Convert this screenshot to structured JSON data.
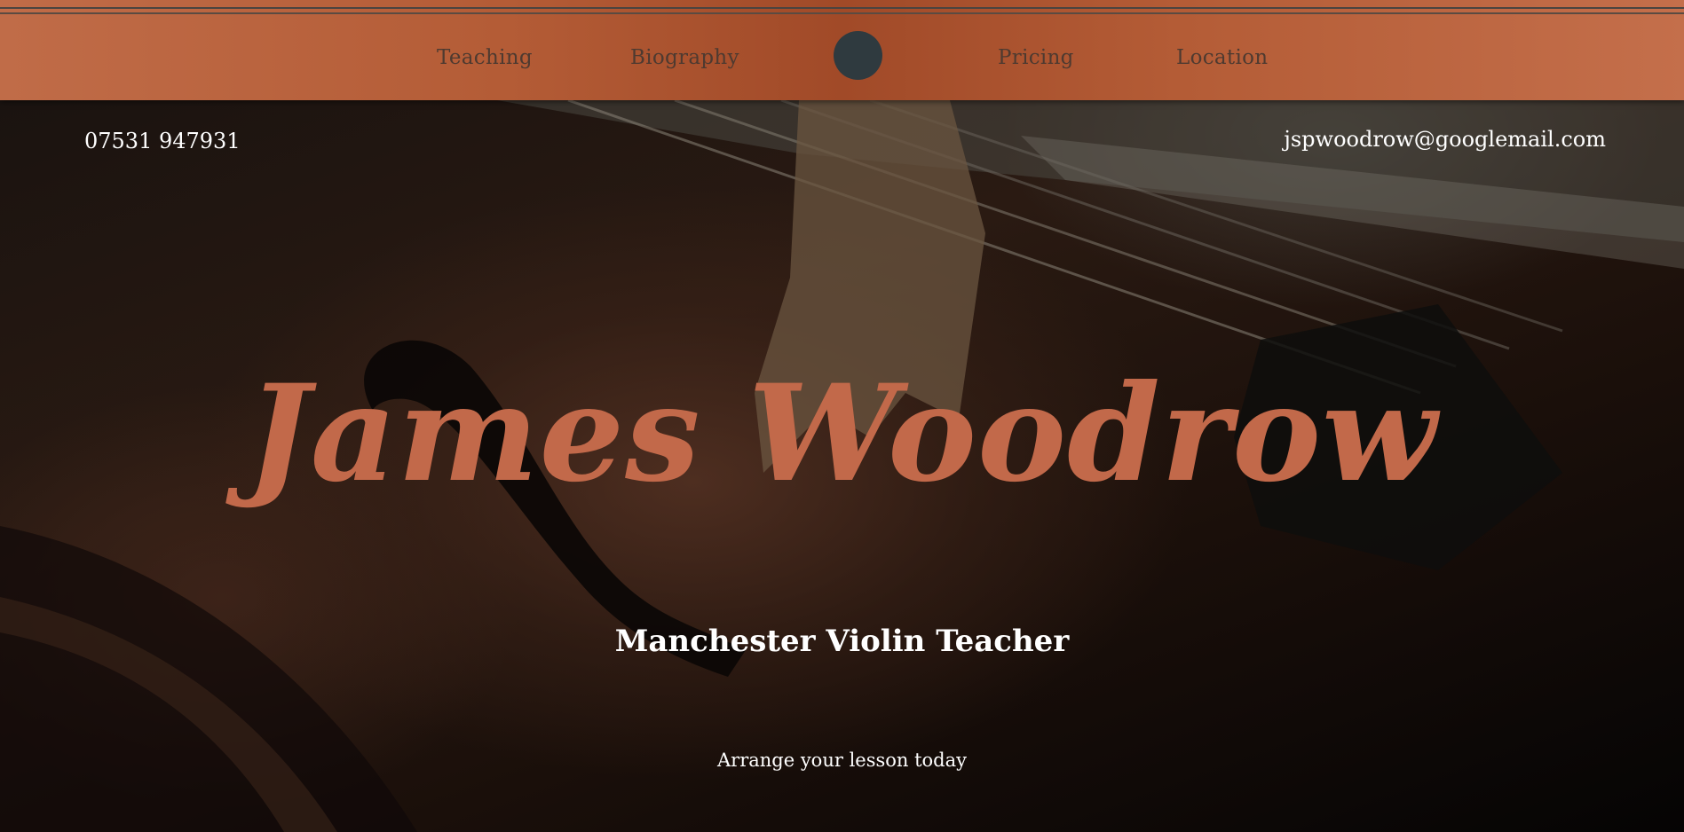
{
  "nav": {
    "items": [
      {
        "label": "Teaching"
      },
      {
        "label": "Biography"
      },
      {
        "label": "Pricing"
      },
      {
        "label": "Location"
      }
    ],
    "logo_color": "#2f3a3f",
    "bar_color": "#b45c36"
  },
  "contact": {
    "phone": "07531 947931",
    "email": "jspwoodrow@googlemail.com"
  },
  "hero": {
    "title": "James Woodrow",
    "subtitle": "Manchester Violin Teacher",
    "cta": "Arrange your lesson today",
    "title_color": "#c2694a"
  }
}
